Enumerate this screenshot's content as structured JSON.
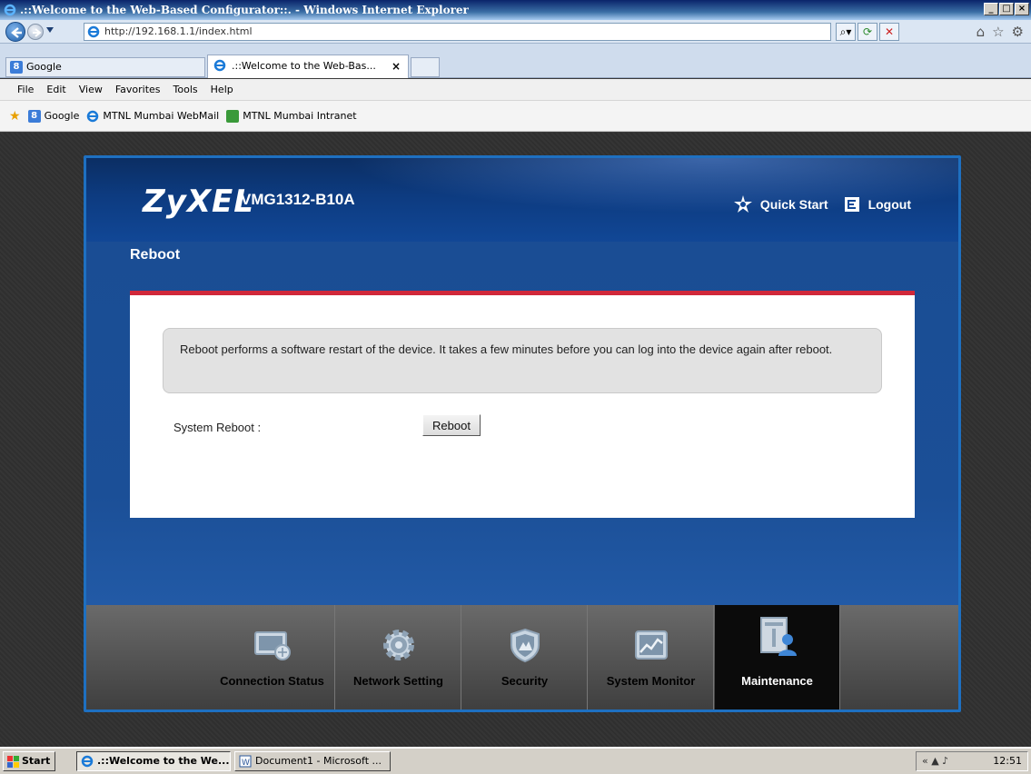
{
  "window": {
    "title": ".::Welcome to the Web-Based Configurator::. - Windows Internet Explorer",
    "controls": {
      "minimize": "_",
      "maximize": "□",
      "close": "×"
    }
  },
  "browser": {
    "url": "http://192.168.1.1/index.html",
    "tabs": [
      {
        "label": "Google"
      },
      {
        "label": ".::Welcome to the Web-Bas...",
        "close": "×"
      }
    ],
    "menu": [
      "File",
      "Edit",
      "View",
      "Favorites",
      "Tools",
      "Help"
    ],
    "favorites": [
      {
        "label": "Google"
      },
      {
        "label": "MTNL Mumbai WebMail"
      },
      {
        "label": "MTNL Mumbai Intranet"
      }
    ]
  },
  "router": {
    "brand": "ZyXEL",
    "model": "VMG1312-B10A",
    "header_links": {
      "quick_start": "Quick Start",
      "logout": "Logout"
    },
    "page_title": "Reboot",
    "notice": "Reboot performs a software restart of the device. It takes a few minutes before you can log into the device again after reboot.",
    "system_reboot_label": "System Reboot :",
    "reboot_button": "Reboot",
    "dock": [
      {
        "label": "Connection Status",
        "icon": "connection-status-icon"
      },
      {
        "label": "Network Setting",
        "icon": "gear-icon"
      },
      {
        "label": "Security",
        "icon": "shield-icon"
      },
      {
        "label": "System Monitor",
        "icon": "monitor-chart-icon"
      },
      {
        "label": "Maintenance",
        "icon": "maintenance-icon",
        "active": true
      }
    ],
    "colors": {
      "accent_red": "#d0283a",
      "header_blue": "#0d3b80",
      "frame_blue": "#1e70c1"
    }
  },
  "taskbar": {
    "start": "Start",
    "items": [
      {
        "label": ".::Welcome to the We...",
        "active": true
      },
      {
        "label": "Document1 - Microsoft ...",
        "active": false
      }
    ],
    "clock": "12:51"
  }
}
